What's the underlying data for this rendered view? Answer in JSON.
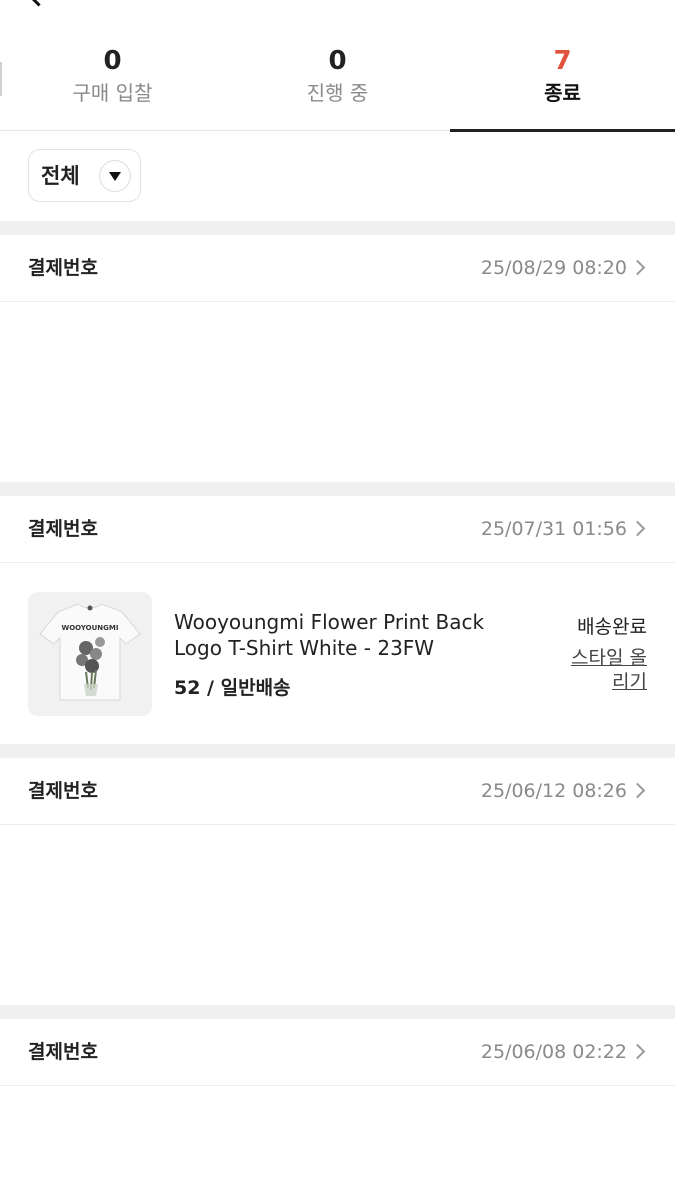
{
  "tabs": [
    {
      "count": "0",
      "label": "구매 입찰"
    },
    {
      "count": "0",
      "label": "진행 중"
    },
    {
      "count": "7",
      "label": "종료"
    }
  ],
  "filter": {
    "label": "전체"
  },
  "orders": [
    {
      "title": "결제번호",
      "date": "25/08/29 08:20"
    },
    {
      "title": "결제번호",
      "date": "25/07/31 01:56"
    },
    {
      "title": "결제번호",
      "date": "25/06/12 08:26"
    },
    {
      "title": "결제번호",
      "date": "25/06/08 02:22"
    }
  ],
  "item": {
    "name": "Wooyoungmi Flower Print Back Logo T-Shirt White - 23FW",
    "size_shipping": "52 / 일반배송",
    "status": "배송완료",
    "style_link": "스타일 올리기",
    "shirt_text": "WOOYOUNGMI"
  },
  "colors": {
    "active_count": "#e0533d",
    "separator": "#f0f0f0",
    "muted_text": "#8a8a8a"
  }
}
